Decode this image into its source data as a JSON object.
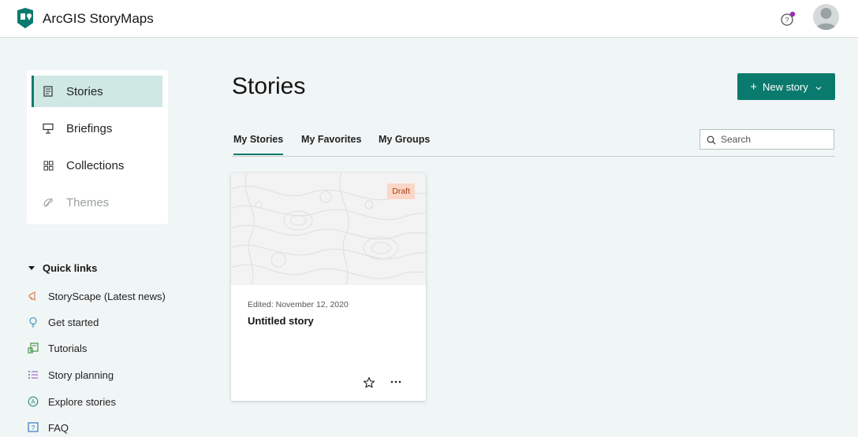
{
  "header": {
    "app_title": "ArcGIS StoryMaps",
    "logo_icon": "storymaps-logo",
    "help_icon": "help-icon",
    "avatar_icon": "user-avatar"
  },
  "sidenav": {
    "items": [
      {
        "label": "Stories",
        "icon": "document-icon",
        "active": true
      },
      {
        "label": "Briefings",
        "icon": "presentation-icon",
        "active": false
      },
      {
        "label": "Collections",
        "icon": "grid-icon",
        "active": false
      },
      {
        "label": "Themes",
        "icon": "palette-icon",
        "active": false,
        "disabled": true
      }
    ]
  },
  "quick_links": {
    "heading": "Quick links",
    "items": [
      {
        "label": "StoryScape (Latest news)",
        "icon": "megaphone-icon"
      },
      {
        "label": "Get started",
        "icon": "lightbulb-icon"
      },
      {
        "label": "Tutorials",
        "icon": "tutorial-icon"
      },
      {
        "label": "Story planning",
        "icon": "list-icon"
      },
      {
        "label": "Explore stories",
        "icon": "explore-icon"
      },
      {
        "label": "FAQ",
        "icon": "faq-icon"
      }
    ]
  },
  "main": {
    "title": "Stories",
    "new_story_label": "New story",
    "tabs": [
      {
        "label": "My Stories",
        "active": true
      },
      {
        "label": "My Favorites",
        "active": false
      },
      {
        "label": "My Groups",
        "active": false
      }
    ],
    "search": {
      "placeholder": "Search",
      "value": ""
    },
    "stories": [
      {
        "badge": "Draft",
        "edited": "Edited: November 12, 2020",
        "title": "Untitled story"
      }
    ]
  },
  "colors": {
    "accent": "#0b7a6e",
    "active_nav_bg": "#cfe8e3",
    "page_bg": "#f0f5f5",
    "draft_badge_bg": "#fbd7c6",
    "draft_badge_text": "#a8401b"
  }
}
